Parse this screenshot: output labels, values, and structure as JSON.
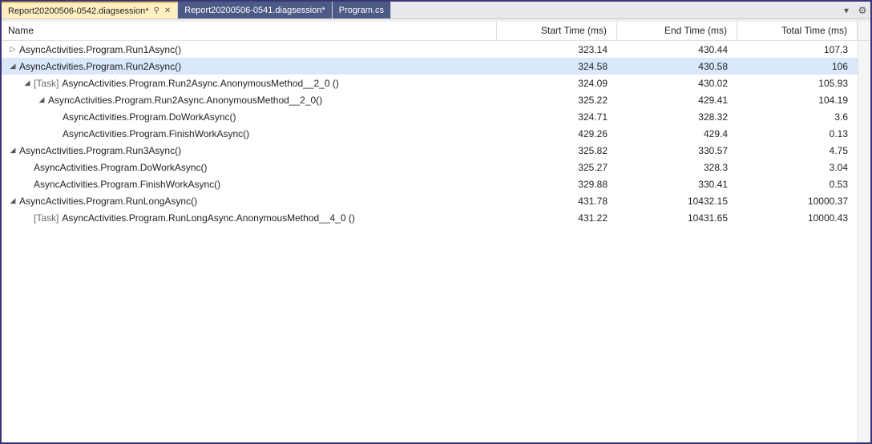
{
  "tabs": [
    {
      "label": "Report20200506-0542.diagsession*",
      "active": true,
      "pinned": true
    },
    {
      "label": "Report20200506-0541.diagsession*",
      "active": false,
      "pinned": false
    },
    {
      "label": "Program.cs",
      "active": false,
      "pinned": false
    }
  ],
  "columns": {
    "name": "Name",
    "start": "Start Time (ms)",
    "end": "End Time (ms)",
    "total": "Total Time (ms)"
  },
  "rows": [
    {
      "depth": 0,
      "expander": "closed",
      "task": false,
      "name": "AsyncActivities.Program.Run1Async()",
      "start": "323.14",
      "end": "430.44",
      "total": "107.3",
      "selected": false
    },
    {
      "depth": 0,
      "expander": "open",
      "task": false,
      "name": "AsyncActivities.Program.Run2Async()",
      "start": "324.58",
      "end": "430.58",
      "total": "106",
      "selected": true
    },
    {
      "depth": 1,
      "expander": "open",
      "task": true,
      "name": "AsyncActivities.Program.Run2Async.AnonymousMethod__2_0 ()",
      "start": "324.09",
      "end": "430.02",
      "total": "105.93",
      "selected": false
    },
    {
      "depth": 2,
      "expander": "open",
      "task": false,
      "name": "AsyncActivities.Program.Run2Async.AnonymousMethod__2_0()",
      "start": "325.22",
      "end": "429.41",
      "total": "104.19",
      "selected": false
    },
    {
      "depth": 3,
      "expander": "none",
      "task": false,
      "name": "AsyncActivities.Program.DoWorkAsync()",
      "start": "324.71",
      "end": "328.32",
      "total": "3.6",
      "selected": false
    },
    {
      "depth": 3,
      "expander": "none",
      "task": false,
      "name": "AsyncActivities.Program.FinishWorkAsync()",
      "start": "429.26",
      "end": "429.4",
      "total": "0.13",
      "selected": false
    },
    {
      "depth": 0,
      "expander": "open",
      "task": false,
      "name": "AsyncActivities.Program.Run3Async()",
      "start": "325.82",
      "end": "330.57",
      "total": "4.75",
      "selected": false
    },
    {
      "depth": 1,
      "expander": "none",
      "task": false,
      "name": "AsyncActivities.Program.DoWorkAsync()",
      "start": "325.27",
      "end": "328.3",
      "total": "3.04",
      "selected": false
    },
    {
      "depth": 1,
      "expander": "none",
      "task": false,
      "name": "AsyncActivities.Program.FinishWorkAsync()",
      "start": "329.88",
      "end": "330.41",
      "total": "0.53",
      "selected": false
    },
    {
      "depth": 0,
      "expander": "open",
      "task": false,
      "name": "AsyncActivities.Program.RunLongAsync()",
      "start": "431.78",
      "end": "10432.15",
      "total": "10000.37",
      "selected": false
    },
    {
      "depth": 1,
      "expander": "none",
      "task": true,
      "name": "AsyncActivities.Program.RunLongAsync.AnonymousMethod__4_0 ()",
      "start": "431.22",
      "end": "10431.65",
      "total": "10000.43",
      "selected": false
    }
  ],
  "taskPrefix": "[Task]",
  "glyphs": {
    "open": "◢",
    "closed": "▷",
    "pin": "⚲",
    "close": "✕",
    "dropdown": "▾",
    "gear": "⚙"
  }
}
